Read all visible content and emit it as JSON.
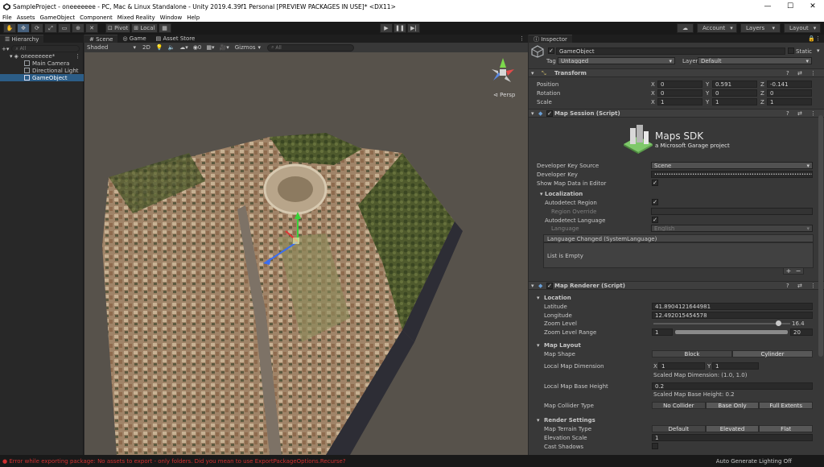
{
  "window": {
    "title": "SampleProject - oneeeeeee - PC, Mac & Linux Standalone - Unity 2019.4.39f1 Personal [PREVIEW PACKAGES IN USE]* <DX11>",
    "minimize": "—",
    "maximize": "☐",
    "close": "✕"
  },
  "menu": [
    "File",
    "Assets",
    "GameObject",
    "Component",
    "Mixed Reality",
    "Window",
    "Help"
  ],
  "toolbar": {
    "pivot": "Pivot",
    "local": "Local",
    "account": "Account",
    "layers": "Layers",
    "layout": "Layout"
  },
  "hierarchy": {
    "tab": "Hierarchy",
    "search_placeholder": "All",
    "scene_name": "oneeeeeee*",
    "items": [
      "Main Camera",
      "Directional Light",
      "GameObject"
    ]
  },
  "scene_view": {
    "tabs": [
      "Scene",
      "Game",
      "Asset Store"
    ],
    "shading": "Shaded",
    "mode_2d": "2D",
    "gizmo_count": "0",
    "gizmos": "Gizmos",
    "search_placeholder": "All",
    "persp": "Persp"
  },
  "inspector": {
    "tab": "Inspector",
    "object_name": "GameObject",
    "static_label": "Static",
    "tag_label": "Tag",
    "tag_value": "Untagged",
    "layer_label": "Layer",
    "layer_value": "Default",
    "transform": {
      "header": "Transform",
      "position_label": "Position",
      "rotation_label": "Rotation",
      "scale_label": "Scale",
      "position": {
        "x": "0",
        "y": "0.591",
        "z": "-0.141"
      },
      "rotation": {
        "x": "0",
        "y": "0",
        "z": "0"
      },
      "scale": {
        "x": "1",
        "y": "1",
        "z": "1"
      }
    },
    "map_session": {
      "header": "Map Session (Script)",
      "logo_title": "Maps SDK",
      "logo_subtitle": "a Microsoft Garage project",
      "dev_key_source_label": "Developer Key Source",
      "dev_key_source_value": "Scene",
      "dev_key_label": "Developer Key",
      "dev_key_value": "••••••••••••••••••••••••••••••••••••••••••••••••••••••••••••••••••••••••••••••••",
      "show_map_label": "Show Map Data in Editor",
      "localization_header": "Localization",
      "autodetect_region": "Autodetect Region",
      "region_override": "Region Override",
      "autodetect_language": "Autodetect Language",
      "language_label": "Language",
      "language_value": "English",
      "event_header": "Language Changed (SystemLanguage)",
      "list_empty": "List is Empty",
      "plus": "+",
      "minus": "−"
    },
    "map_renderer": {
      "header": "Map Renderer (Script)",
      "location_header": "Location",
      "latitude_label": "Latitude",
      "latitude_value": "41.8904121644981",
      "longitude_label": "Longitude",
      "longitude_value": "12.492015454578",
      "zoom_label": "Zoom Level",
      "zoom_value": "16.4",
      "zoom_fraction": 0.93,
      "zoom_range_label": "Zoom Level Range",
      "zoom_range_min": "1",
      "zoom_range_max": "20",
      "layout_header": "Map Layout",
      "shape_label": "Map Shape",
      "shape_options": [
        "Block",
        "Cylinder"
      ],
      "dimension_label": "Local Map Dimension",
      "dimension_x": "1",
      "dimension_y": "1",
      "scaled_dimension": "Scaled Map Dimension: (1.0, 1.0)",
      "base_height_label": "Local Map Base Height",
      "base_height_value": "0.2",
      "scaled_base_height": "Scaled Map Base Height: 0.2",
      "collider_label": "Map Collider Type",
      "collider_options": [
        "No Collider",
        "Base Only",
        "Full Extents"
      ],
      "render_header": "Render Settings",
      "terrain_label": "Map Terrain Type",
      "terrain_options": [
        "Default",
        "Elevated",
        "Flat"
      ],
      "elevation_label": "Elevation Scale",
      "elevation_value": "1",
      "cast_shadows_label": "Cast Shadows"
    }
  },
  "status": {
    "error": "Error while exporting package: No assets to export - only folders. Did you mean to use ExportPackageOptions.Recurse?",
    "right": "Auto Generate Lighting Off"
  },
  "colors": {
    "selection": "#2c5d87",
    "panel": "#383838",
    "error": "#d03030"
  }
}
